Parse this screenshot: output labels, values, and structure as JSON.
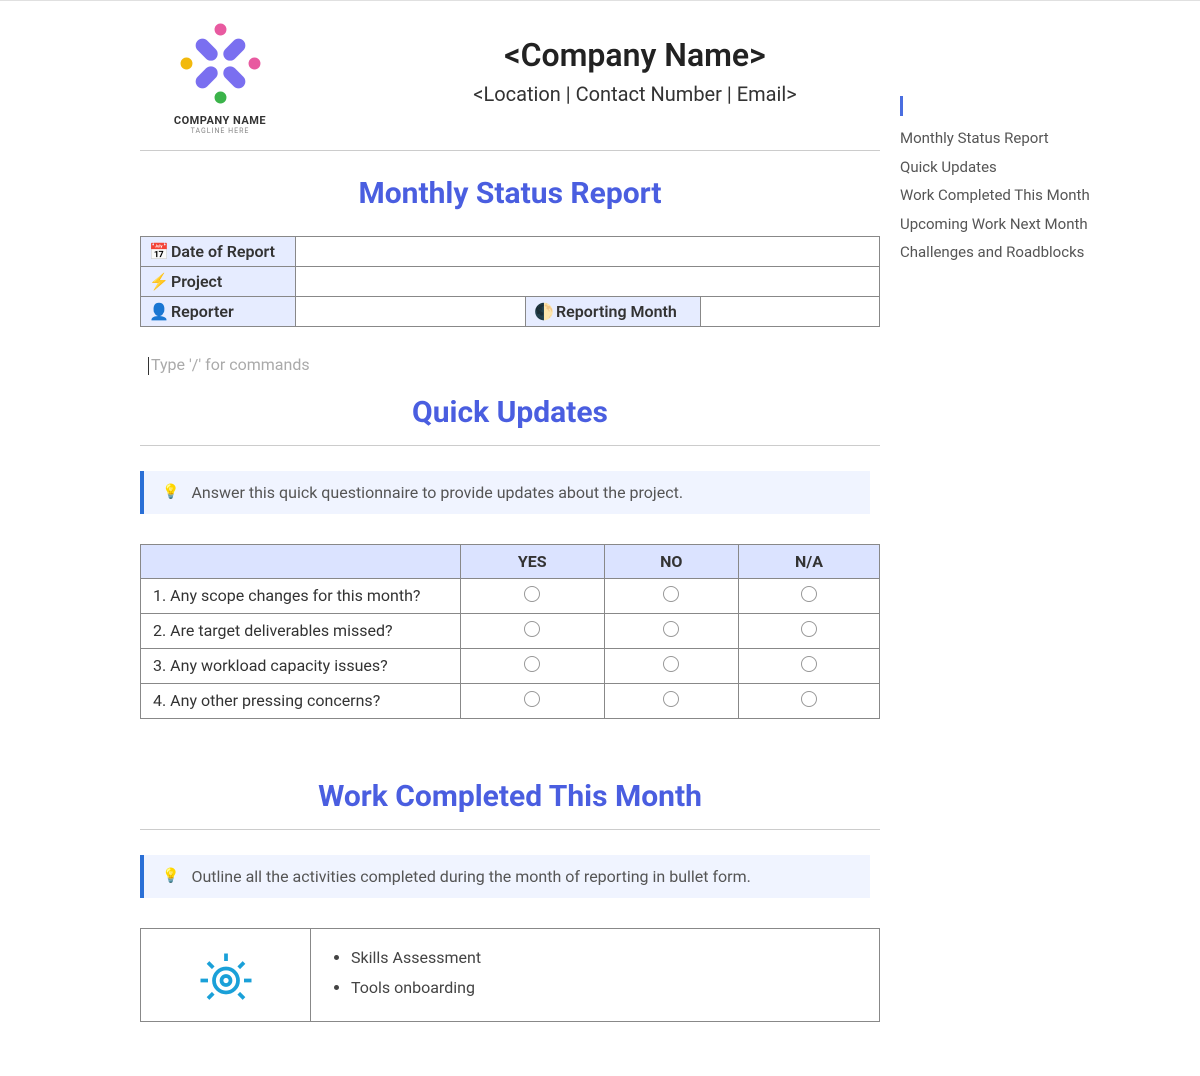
{
  "header": {
    "logo_label": "COMPANY NAME",
    "logo_tagline": "TAGLINE HERE",
    "company_name": "<Company Name>",
    "company_sub": "<Location | Contact Number | Email>"
  },
  "sections": {
    "monthly_title": "Monthly Status Report",
    "quick_updates_title": "Quick Updates",
    "work_completed_title": "Work Completed This Month"
  },
  "info_fields": {
    "date_of_report": {
      "label": "Date of Report",
      "value": ""
    },
    "project": {
      "label": "Project",
      "value": ""
    },
    "reporter": {
      "label": "Reporter",
      "value": ""
    },
    "reporting_month": {
      "label": "Reporting Month",
      "value": ""
    }
  },
  "editor_placeholder": "Type '/' for commands",
  "quick_updates": {
    "callout": "Answer this quick questionnaire to provide updates about the project.",
    "columns": {
      "yes": "YES",
      "no": "NO",
      "na": "N/A"
    },
    "questions": [
      "1.   Any scope changes for this month?",
      "2.   Are target deliverables missed?",
      "3.   Any workload capacity issues?",
      "4.   Any other pressing concerns?"
    ]
  },
  "work_completed": {
    "callout": "Outline all the activities completed during the month of reporting in bullet form.",
    "bullets": [
      "Skills Assessment",
      "Tools onboarding"
    ]
  },
  "outline": [
    "Monthly Status Report",
    "Quick Updates",
    "Work Completed This Month",
    "Upcoming Work Next Month",
    "Challenges and Roadblocks"
  ]
}
